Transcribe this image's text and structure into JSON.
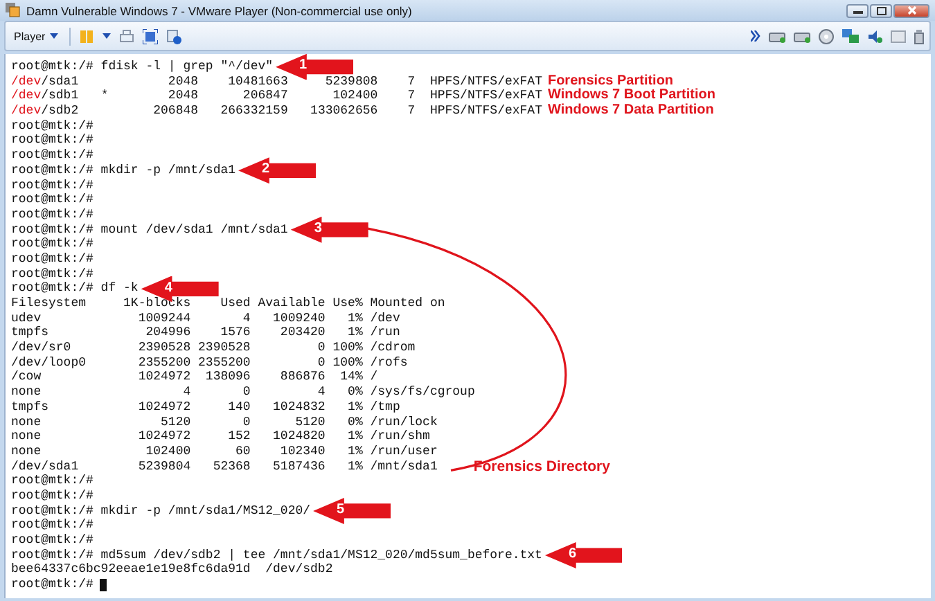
{
  "window": {
    "title": "Damn Vulnerable Windows 7 - VMware Player (Non-commercial use only)"
  },
  "toolbar": {
    "menu": "Player"
  },
  "terminal": {
    "lines": [
      {
        "kind": "plain",
        "text": "root@mtk:/# fdisk -l | grep \"^/dev\"",
        "callout": "1"
      },
      {
        "kind": "partition",
        "prefix": "/dev",
        "text": "/sda1            2048    10481663     5239808    7  HPFS/NTFS/exFAT",
        "note": "Forensics Partition"
      },
      {
        "kind": "partition",
        "prefix": "/dev",
        "text": "/sdb1   *        2048      206847      102400    7  HPFS/NTFS/exFAT",
        "note": "Windows 7 Boot Partition"
      },
      {
        "kind": "partition",
        "prefix": "/dev",
        "text": "/sdb2          206848   266332159   133062656    7  HPFS/NTFS/exFAT",
        "note": "Windows 7 Data Partition"
      },
      {
        "kind": "plain",
        "text": "root@mtk:/#"
      },
      {
        "kind": "plain",
        "text": "root@mtk:/#"
      },
      {
        "kind": "plain",
        "text": "root@mtk:/#"
      },
      {
        "kind": "plain",
        "text": "root@mtk:/# mkdir -p /mnt/sda1",
        "callout": "2"
      },
      {
        "kind": "plain",
        "text": "root@mtk:/#"
      },
      {
        "kind": "plain",
        "text": "root@mtk:/#"
      },
      {
        "kind": "plain",
        "text": "root@mtk:/#"
      },
      {
        "kind": "plain",
        "text": "root@mtk:/# mount /dev/sda1 /mnt/sda1",
        "callout": "3"
      },
      {
        "kind": "plain",
        "text": "root@mtk:/#"
      },
      {
        "kind": "plain",
        "text": "root@mtk:/#"
      },
      {
        "kind": "plain",
        "text": "root@mtk:/#"
      },
      {
        "kind": "plain",
        "text": "root@mtk:/# df -k",
        "callout": "4"
      },
      {
        "kind": "plain",
        "text": "Filesystem     1K-blocks    Used Available Use% Mounted on"
      },
      {
        "kind": "plain",
        "text": "udev             1009244       4   1009240   1% /dev"
      },
      {
        "kind": "plain",
        "text": "tmpfs             204996    1576    203420   1% /run"
      },
      {
        "kind": "plain",
        "text": "/dev/sr0         2390528 2390528         0 100% /cdrom"
      },
      {
        "kind": "plain",
        "text": "/dev/loop0       2355200 2355200         0 100% /rofs"
      },
      {
        "kind": "plain",
        "text": "/cow             1024972  138096    886876  14% /"
      },
      {
        "kind": "plain",
        "text": "none                   4       0         4   0% /sys/fs/cgroup"
      },
      {
        "kind": "plain",
        "text": "tmpfs            1024972     140   1024832   1% /tmp"
      },
      {
        "kind": "plain",
        "text": "none                5120       0      5120   0% /run/lock"
      },
      {
        "kind": "plain",
        "text": "none             1024972     152   1024820   1% /run/shm"
      },
      {
        "kind": "plain",
        "text": "none              102400      60    102340   1% /run/user"
      },
      {
        "kind": "plain",
        "text": "/dev/sda1        5239804   52368   5187436   1% /mnt/sda1",
        "annotation": "Forensics Directory"
      },
      {
        "kind": "plain",
        "text": "root@mtk:/#"
      },
      {
        "kind": "plain",
        "text": "root@mtk:/#"
      },
      {
        "kind": "plain",
        "text": "root@mtk:/# mkdir -p /mnt/sda1/MS12_020/",
        "callout": "5"
      },
      {
        "kind": "plain",
        "text": "root@mtk:/#"
      },
      {
        "kind": "plain",
        "text": "root@mtk:/#"
      },
      {
        "kind": "plain",
        "text": "root@mtk:/# md5sum /dev/sdb2 | tee /mnt/sda1/MS12_020/md5sum_before.txt",
        "callout": "6"
      },
      {
        "kind": "plain",
        "text": "bee64337c6bc92eeae1e19e8fc6da91d  /dev/sdb2"
      },
      {
        "kind": "plain",
        "text": "root@mtk:/#",
        "cursor": true
      }
    ]
  }
}
